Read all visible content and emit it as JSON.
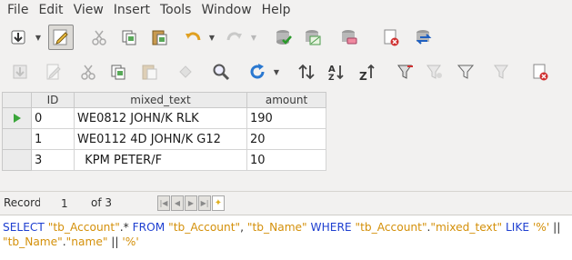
{
  "menu": [
    "File",
    "Edit",
    "View",
    "Insert",
    "Tools",
    "Window",
    "Help"
  ],
  "toolbar1": [
    {
      "icon": "download-arrow-icon"
    },
    {
      "icon": "pencil-edit-icon"
    },
    {
      "icon": "cut-icon"
    },
    {
      "icon": "copy-icon"
    },
    {
      "icon": "paste-icon"
    },
    {
      "icon": "undo-icon"
    },
    {
      "icon": "redo-icon"
    },
    {
      "icon": "database-check-icon"
    },
    {
      "icon": "table-design-icon"
    },
    {
      "icon": "database-erase-icon"
    },
    {
      "icon": "delete-record-icon"
    },
    {
      "icon": "database-exchange-icon"
    }
  ],
  "toolbar2": [
    {
      "icon": "save-record-icon"
    },
    {
      "icon": "edit-record-icon"
    },
    {
      "icon": "cut-icon"
    },
    {
      "icon": "copy-icon"
    },
    {
      "icon": "paste-icon"
    },
    {
      "icon": "search-icon"
    },
    {
      "icon": "refresh-icon"
    },
    {
      "icon": "sort-icon"
    },
    {
      "icon": "sort-ascending-icon"
    },
    {
      "icon": "sort-descending-icon"
    },
    {
      "icon": "autofilter-icon"
    },
    {
      "icon": "standard-filter-icon"
    },
    {
      "icon": "remove-filter-icon"
    },
    {
      "icon": "form-filter-icon"
    },
    {
      "icon": "delete-record-icon"
    }
  ],
  "grid": {
    "columns": [
      "ID",
      "mixed_text",
      "amount"
    ],
    "rows": [
      {
        "id": "0",
        "mixed_text": "WE0812 JOHN/K RLK",
        "amount": "190"
      },
      {
        "id": "1",
        "mixed_text": "WE0112 4D JOHN/K G12",
        "amount": "20"
      },
      {
        "id": "3",
        "mixed_text": "  KPM PETER/F",
        "amount": "10"
      }
    ]
  },
  "navigation": {
    "record_label": "Record",
    "record_value": "1",
    "of_label": "of 3"
  },
  "sql": {
    "tokens": [
      {
        "t": "SELECT ",
        "c": "kw"
      },
      {
        "t": "\"tb_Account\"",
        "c": "str"
      },
      {
        "t": ".* ",
        "c": "op"
      },
      {
        "t": "FROM ",
        "c": "kw"
      },
      {
        "t": "\"tb_Account\"",
        "c": "str"
      },
      {
        "t": ", ",
        "c": "op"
      },
      {
        "t": "\"tb_Name\" ",
        "c": "str"
      },
      {
        "t": "WHERE ",
        "c": "kw"
      },
      {
        "t": "\"tb_Account\"",
        "c": "str"
      },
      {
        "t": ".",
        "c": "op"
      },
      {
        "t": "\"mixed_text\" ",
        "c": "str"
      },
      {
        "t": "LIKE ",
        "c": "kw"
      },
      {
        "t": "'%'",
        "c": "str"
      },
      {
        "t": " || ",
        "c": "op"
      },
      {
        "t": "\"tb_Name\"",
        "c": "str"
      },
      {
        "t": ".",
        "c": "op"
      },
      {
        "t": "\"name\"",
        "c": "str"
      },
      {
        "t": " || ",
        "c": "op"
      },
      {
        "t": "'%'",
        "c": "str"
      }
    ]
  },
  "colors": {
    "keyword": "#1e3fd0",
    "string": "#d4900a",
    "current_row_marker": "#3aa63a"
  }
}
